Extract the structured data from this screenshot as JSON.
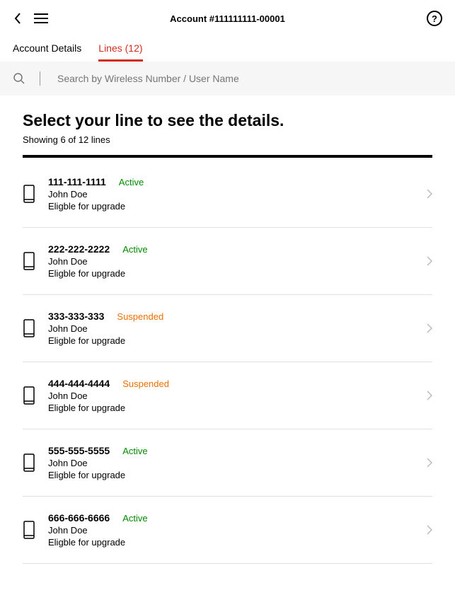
{
  "header": {
    "title": "Account #111111111-00001"
  },
  "tabs": {
    "account_details": "Account Details",
    "lines": "Lines (12)"
  },
  "search": {
    "placeholder": "Search by Wireless Number / User Name"
  },
  "main": {
    "title": "Select your line to see the details.",
    "subtitle": "Showing 6 of 12 lines"
  },
  "status_labels": {
    "active": "Active",
    "suspended": "Suspended"
  },
  "lines": [
    {
      "number": "111-111-1111",
      "status": "Active",
      "status_class": "active",
      "user": "John Doe",
      "eligible": "Eligble for upgrade"
    },
    {
      "number": "222-222-2222",
      "status": "Active",
      "status_class": "active",
      "user": "John Doe",
      "eligible": "Eligble for upgrade"
    },
    {
      "number": "333-333-333",
      "status": "Suspended",
      "status_class": "suspended",
      "user": "John Doe",
      "eligible": "Eligble for upgrade"
    },
    {
      "number": "444-444-4444",
      "status": "Suspended",
      "status_class": "suspended",
      "user": "John Doe",
      "eligible": "Eligble for upgrade"
    },
    {
      "number": "555-555-5555",
      "status": "Active",
      "status_class": "active",
      "user": "John Doe",
      "eligible": "Eligble for upgrade"
    },
    {
      "number": "666-666-6666",
      "status": "Active",
      "status_class": "active",
      "user": "John Doe",
      "eligible": "Eligble for upgrade"
    }
  ]
}
